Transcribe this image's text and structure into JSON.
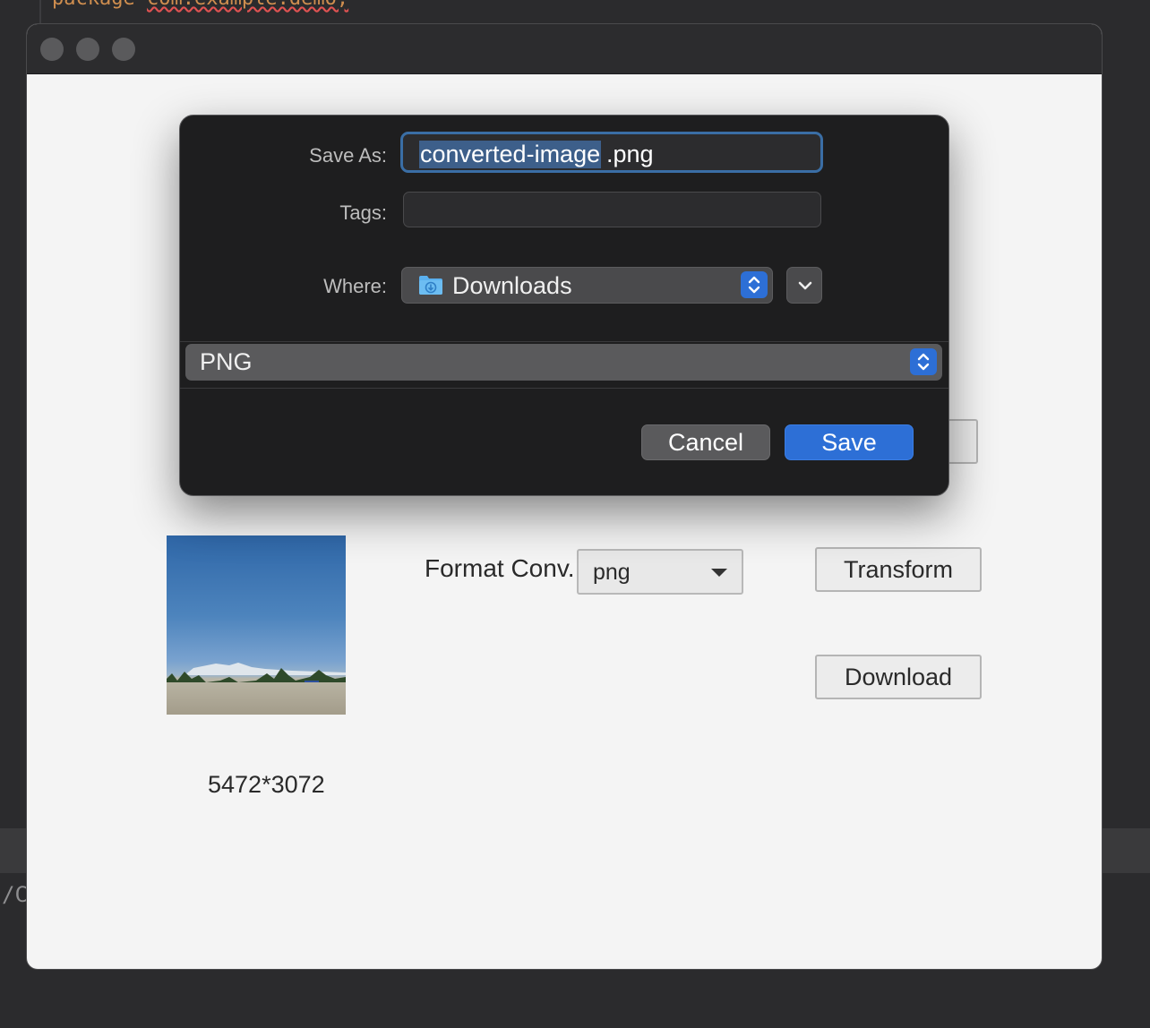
{
  "ide": {
    "code_line": "package com.example.demo;",
    "code_keyword": "package",
    "code_rest": "com.example.demo;",
    "path_fragment": "/C"
  },
  "app": {
    "image_dimensions": "5472*3072",
    "format_label": "Format Conv.",
    "format_selected": "png",
    "transform_label": "Transform",
    "download_label": "Download"
  },
  "save_dialog": {
    "save_as_label": "Save As:",
    "filename_selected": "converted-image",
    "filename_ext": ".png",
    "tags_label": "Tags:",
    "tags_value": "",
    "where_label": "Where:",
    "where_value": "Downloads",
    "file_type": "PNG",
    "cancel_label": "Cancel",
    "save_label": "Save"
  },
  "colors": {
    "accent": "#2d6fd6",
    "focus_ring": "#3a6ea5",
    "sheet_bg": "#1e1e1f"
  }
}
